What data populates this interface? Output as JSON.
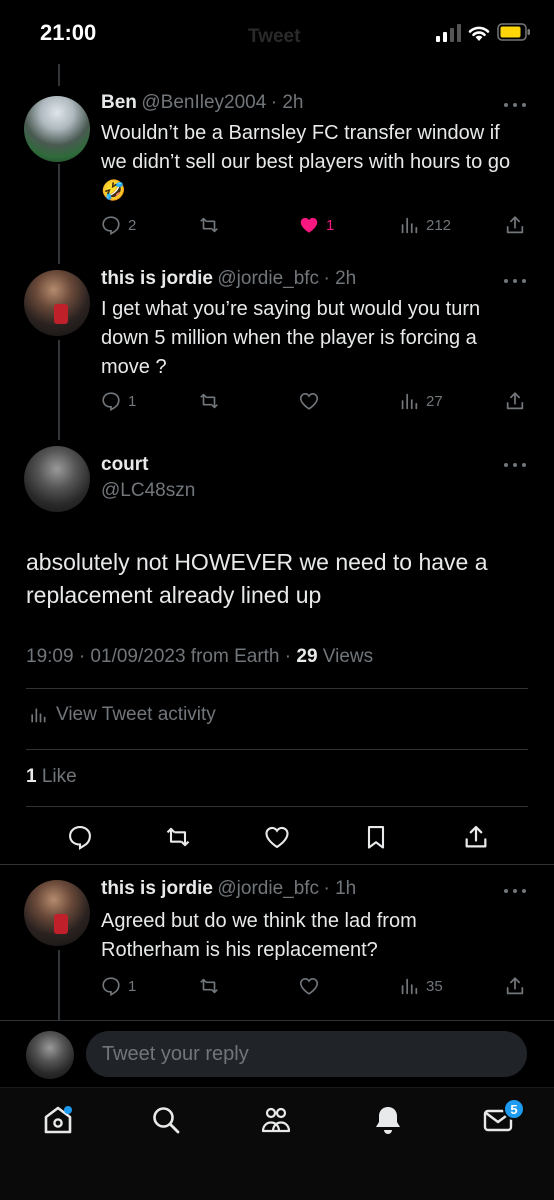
{
  "status_bar": {
    "time": "21:00",
    "center_faded": "Tweet"
  },
  "tweets": [
    {
      "name": "Ben",
      "handle": "@BenIley2004",
      "time": "· 2h",
      "text": "Wouldn’t be a Barnsley FC transfer window if we didn’t sell our best players with hours to go🤣",
      "replies": "2",
      "likes": "1",
      "views": "212",
      "liked": true
    },
    {
      "name": "this is jordie",
      "handle": "@jordie_bfc",
      "time": "· 2h",
      "text": "I get what you’re saying but would you turn down 5 million when the player is forcing a move ?",
      "replies": "1",
      "views": "27"
    }
  ],
  "main_tweet": {
    "name": "court",
    "handle": "@LC48szn",
    "text": "absolutely not HOWEVER we need to have a replacement already lined up",
    "meta_time": "19:09 · 01/09/2023 from Earth · ",
    "views_count": "29",
    "views_label": " Views",
    "activity_label": "View Tweet activity",
    "likes_count": "1",
    "likes_label": " Like"
  },
  "reply_tweet": {
    "name": "this is jordie",
    "handle": "@jordie_bfc",
    "time": "· 1h",
    "text": "Agreed but do we think the lad from Rotherham is his replacement?",
    "replies": "1",
    "views": "35"
  },
  "composer": {
    "placeholder": "Tweet your reply"
  },
  "bottom_nav": {
    "messages_badge": "5"
  },
  "colors": {
    "background": "#000000",
    "text": "#e7e9ea",
    "muted": "#71767b",
    "like": "#f91880",
    "accent": "#1d9bf0",
    "battery": "#ffd60a"
  }
}
